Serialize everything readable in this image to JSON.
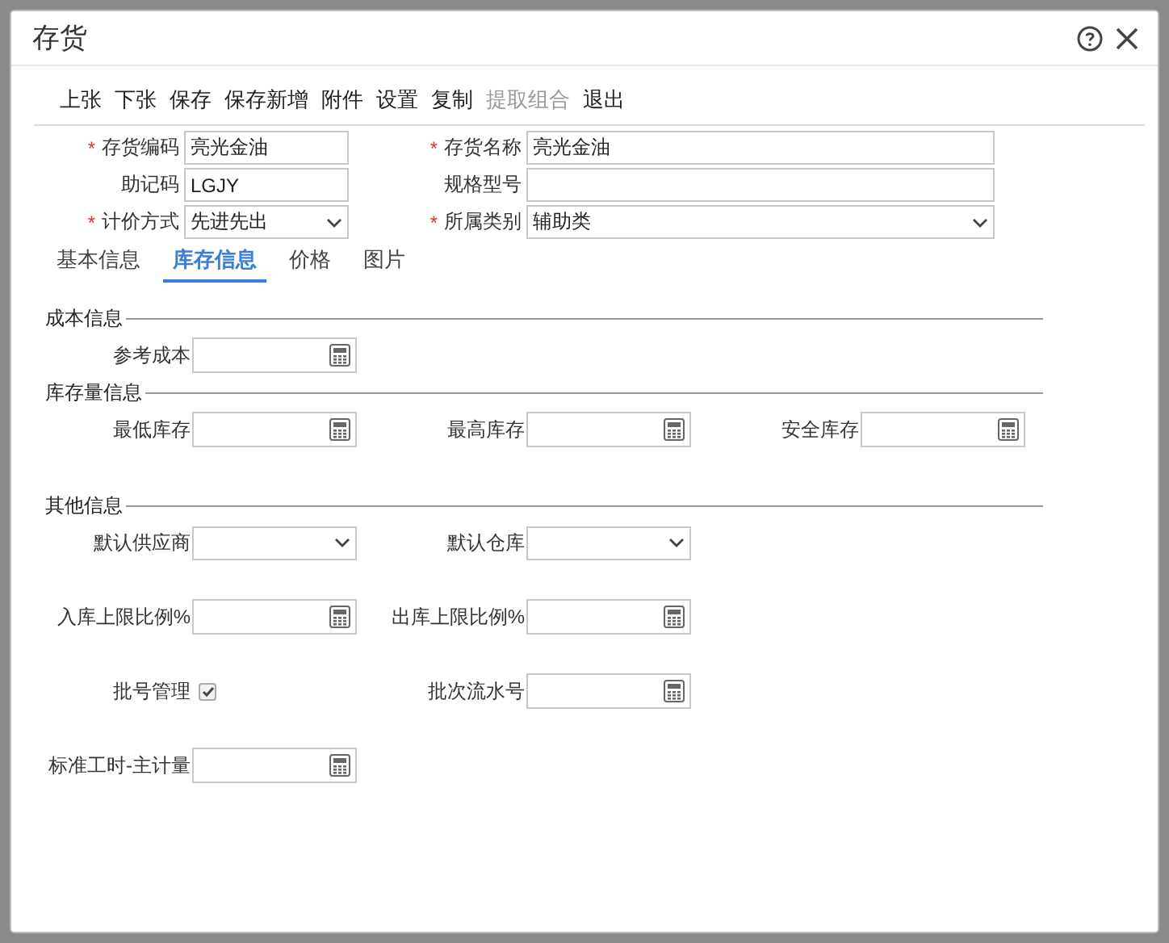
{
  "window": {
    "title": "存货"
  },
  "toolbar": [
    {
      "label": "上张",
      "disabled": false
    },
    {
      "label": "下张",
      "disabled": false
    },
    {
      "label": "保存",
      "disabled": false
    },
    {
      "label": "保存新增",
      "disabled": false
    },
    {
      "label": "附件",
      "disabled": false
    },
    {
      "label": "设置",
      "disabled": false
    },
    {
      "label": "复制",
      "disabled": false
    },
    {
      "label": "提取组合",
      "disabled": true
    },
    {
      "label": "退出",
      "disabled": false
    }
  ],
  "header_fields": [
    {
      "marker": "*",
      "label": "存货编码",
      "kind": "text",
      "value": "亮光金油"
    },
    {
      "marker": "*",
      "label": "存货名称",
      "kind": "text",
      "value": "亮光金油"
    },
    {
      "label": "助记码",
      "kind": "text",
      "value": "LGJY"
    },
    {
      "label": "规格型号",
      "kind": "text"
    },
    {
      "marker": "*",
      "label": "计价方式",
      "kind": "select",
      "value": "先进先出"
    },
    {
      "marker": "*",
      "label": "所属类别",
      "kind": "select",
      "value": "辅助类"
    }
  ],
  "tabs": [
    {
      "label": "基本信息",
      "selected": false
    },
    {
      "label": "库存信息",
      "selected": true
    },
    {
      "label": "价格",
      "selected": false
    },
    {
      "label": "图片",
      "selected": false
    }
  ],
  "sections": [
    {
      "title": "成本信息",
      "rows": [
        [
          {
            "label": "参考成本",
            "kind": "number"
          }
        ]
      ]
    },
    {
      "title": "库存量信息",
      "rows": [
        [
          {
            "label": "最低库存",
            "kind": "number"
          },
          {
            "label": "最高库存",
            "kind": "number"
          },
          {
            "label": "安全库存",
            "kind": "number"
          }
        ]
      ]
    },
    {
      "title": "其他信息",
      "rows": [
        [
          {
            "label": "默认供应商",
            "kind": "select"
          },
          {
            "label": "默认仓库",
            "kind": "select"
          }
        ],
        [
          {
            "label": "入库上限比例%",
            "kind": "number"
          },
          {
            "label": "出库上限比例%",
            "kind": "number"
          }
        ],
        [
          {
            "label": "批号管理",
            "kind": "checkbox",
            "checked": true
          },
          {
            "label": "批次流水号",
            "kind": "number"
          }
        ],
        [
          {
            "label": "标准工时-主计量",
            "kind": "number"
          }
        ]
      ]
    }
  ]
}
